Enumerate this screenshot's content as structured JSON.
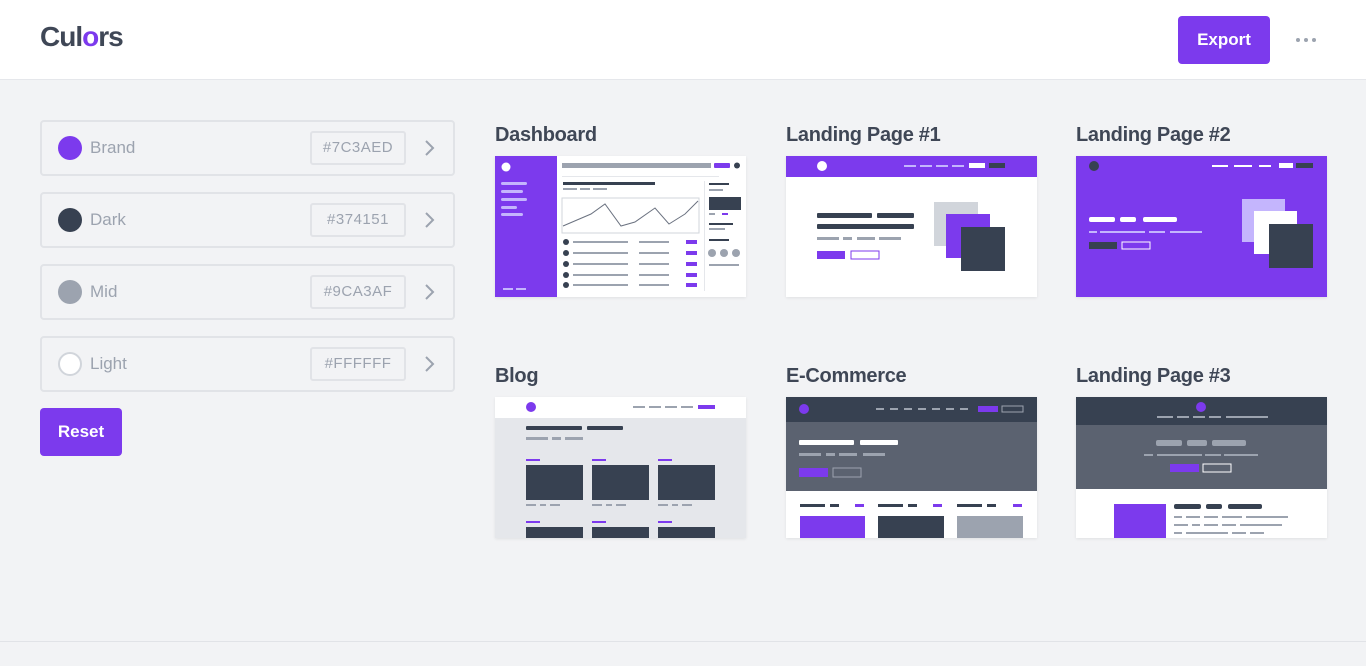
{
  "app": {
    "logo_prefix": "Cul",
    "logo_o": "o",
    "logo_suffix": "rs"
  },
  "header": {
    "export_label": "Export",
    "more_icon": "more-horizontal-icon"
  },
  "colors": [
    {
      "name": "Brand",
      "hex": "#7C3AED",
      "swatch": "#7C3AED"
    },
    {
      "name": "Dark",
      "hex": "#374151",
      "swatch": "#374151"
    },
    {
      "name": "Mid",
      "hex": "#9CA3AF",
      "swatch": "#9CA3AF"
    },
    {
      "name": "Light",
      "hex": "#FFFFFF",
      "swatch": "#FFFFFF"
    }
  ],
  "reset_label": "Reset",
  "templates": [
    {
      "title": "Dashboard"
    },
    {
      "title": "Landing Page #1"
    },
    {
      "title": "Landing Page #2"
    },
    {
      "title": "Blog"
    },
    {
      "title": "E-Commerce"
    },
    {
      "title": "Landing Page #3"
    }
  ]
}
